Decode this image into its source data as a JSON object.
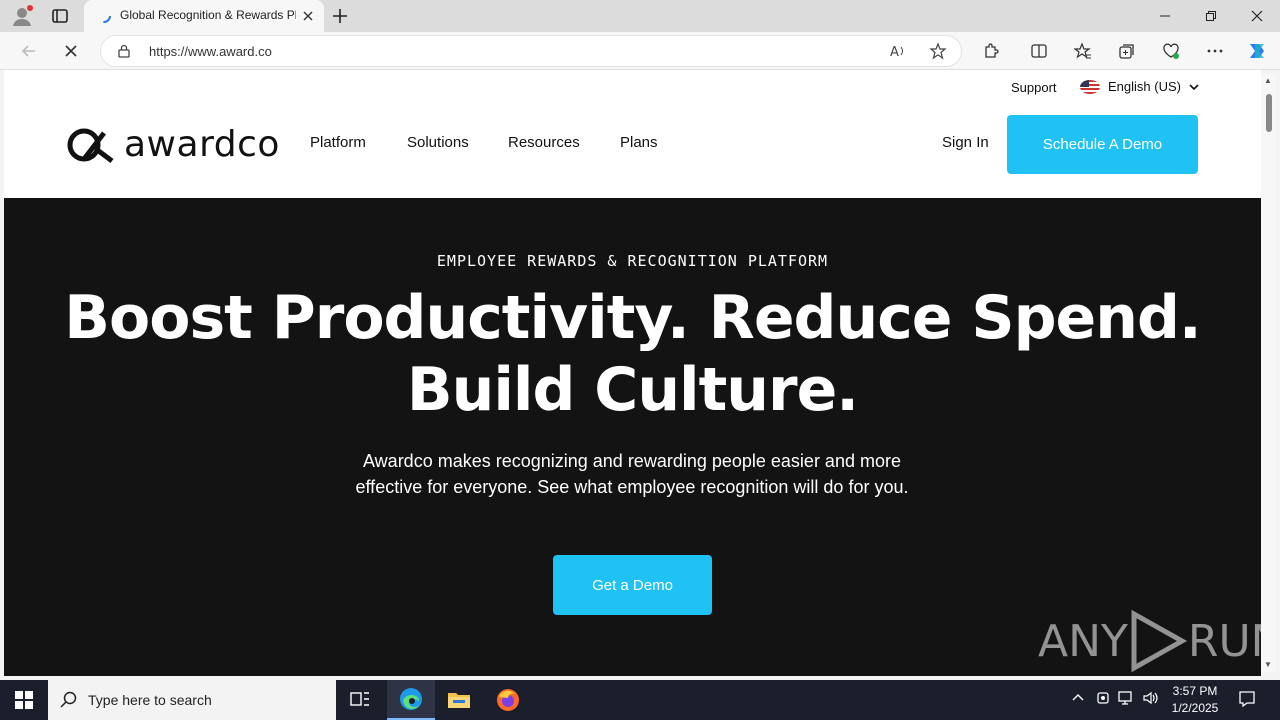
{
  "browser": {
    "tab_title": "Global Recognition & Rewards Pl",
    "url": "https://www.award.co",
    "icons": [
      "profile-icon",
      "tab-actions-icon",
      "close-tab-icon",
      "new-tab-icon",
      "minimize-icon",
      "restore-icon",
      "close-window-icon",
      "back-icon",
      "stop-loading-icon",
      "lock-icon",
      "read-aloud-icon",
      "favorite-icon",
      "extensions-icon",
      "split-screen-icon",
      "favorites-icon",
      "collections-icon",
      "browser-essentials-icon",
      "more-icon",
      "copilot-icon"
    ]
  },
  "site": {
    "support": "Support",
    "language": "English (US)",
    "logo": "awardco",
    "nav": [
      "Platform",
      "Solutions",
      "Resources",
      "Plans"
    ],
    "sign_in": "Sign In",
    "schedule_demo": "Schedule A Demo"
  },
  "hero": {
    "eyebrow": "EMPLOYEE REWARDS & RECOGNITION PLATFORM",
    "headline_line1": "Boost Productivity. Reduce Spend.",
    "headline_line2": "Build Culture.",
    "subtext_line1": "Awardco makes recognizing and rewarding people easier and more",
    "subtext_line2": "effective for everyone. See what employee recognition will do for you.",
    "cta": "Get a Demo"
  },
  "watermark": {
    "left": "ANY",
    "right": "RUN"
  },
  "taskbar": {
    "search_placeholder": "Type here to search",
    "time": "3:57 PM",
    "date": "1/2/2025"
  },
  "colors": {
    "accent": "#1fc2f2",
    "hero_bg": "#131313",
    "taskbar_bg": "#1b1e2b"
  }
}
